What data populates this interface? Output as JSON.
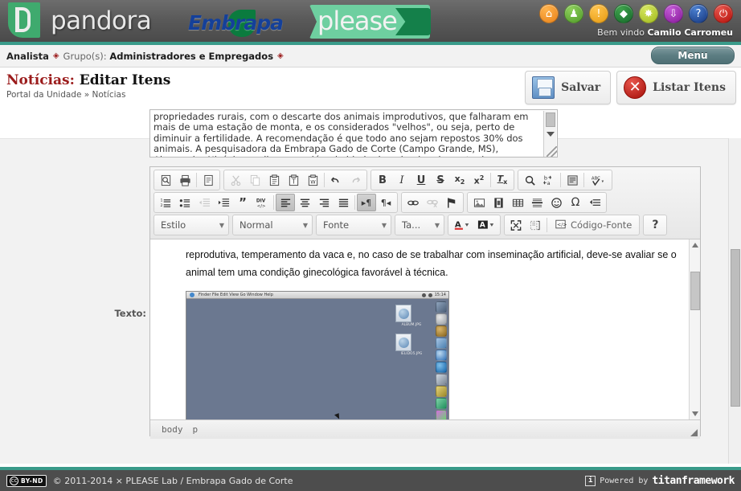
{
  "header": {
    "logos": {
      "pandora": "pandora",
      "embrapa": "Embrapa",
      "please": "please"
    },
    "icons": [
      {
        "name": "home-icon",
        "glyph": "⌂"
      },
      {
        "name": "user-icon",
        "glyph": "♟"
      },
      {
        "name": "alert-icon",
        "glyph": "!"
      },
      {
        "name": "brazil-flag-icon",
        "glyph": "◆"
      },
      {
        "name": "config-icon",
        "glyph": "✸"
      },
      {
        "name": "download-icon",
        "glyph": "⬇"
      },
      {
        "name": "shield-help-icon",
        "glyph": "?"
      },
      {
        "name": "power-logout-icon",
        "glyph": "⏻"
      }
    ],
    "welcome_prefix": "Bem vindo ",
    "welcome_user": "Camilo Carromeu"
  },
  "navbar": {
    "role": "Analista",
    "diamond": "◈",
    "groups_label": "Grupo(s):",
    "groups_value": "Administradores e Empregados",
    "menu_label": "Menu"
  },
  "page": {
    "title_highlight": "Notícias:",
    "title_rest": " Editar Itens",
    "breadcrumb": "Portal da Unidade » Notícias",
    "actions": [
      {
        "name": "save-button",
        "label": "Salvar",
        "icon": "floppy-disk-icon"
      },
      {
        "name": "list-items-button",
        "label": "Listar Itens",
        "icon": "red-x-circle-icon"
      }
    ]
  },
  "top_textarea": {
    "value": "propriedades rurais, com o descarte dos animais improdutivos, que falharam em mais de uma estação de monta, e os considerados \"velhos\", ou seja, perto de diminuir a fertilidade. A recomendação é que todo ano sejam repostos 30% dos animais. A pesquisadora da Embrapa Gado de Corte (Campo Grande, MS), Alessandra Nicácio, explica que, além da idade do animal, o descarte deve considerar vários critérios."
  },
  "form": {
    "text_label": "Texto:"
  },
  "editor": {
    "toolbar_row1": {
      "group1": [
        {
          "name": "preview-icon",
          "title": "Visualizar"
        },
        {
          "name": "print-icon",
          "title": "Imprimir"
        },
        {
          "name": "templates-icon",
          "title": "Modelos"
        }
      ],
      "group2": [
        {
          "name": "cut-icon",
          "title": "Recortar",
          "disabled": true
        },
        {
          "name": "copy-icon",
          "title": "Copiar",
          "disabled": true
        },
        {
          "name": "paste-icon",
          "title": "Colar"
        },
        {
          "name": "paste-text-icon",
          "title": "Colar como texto sem formatação"
        },
        {
          "name": "paste-word-icon",
          "title": "Colar do Word"
        },
        {
          "name": "undo-icon",
          "title": "Desfazer"
        },
        {
          "name": "redo-icon",
          "title": "Refazer",
          "disabled": true
        }
      ],
      "group3": [
        {
          "name": "bold-icon",
          "label": "B"
        },
        {
          "name": "italic-icon",
          "label": "I"
        },
        {
          "name": "underline-icon",
          "label": "U"
        },
        {
          "name": "strikethrough-icon",
          "label": "S"
        },
        {
          "name": "subscript-icon",
          "label": "x₂"
        },
        {
          "name": "superscript-icon",
          "label": "x²"
        },
        {
          "name": "remove-format-icon",
          "label": "Tx"
        }
      ],
      "group4": [
        {
          "name": "find-icon",
          "title": "Localizar"
        },
        {
          "name": "replace-icon",
          "title": "Substituir"
        },
        {
          "name": "select-all-icon",
          "title": "Selecionar Tudo"
        },
        {
          "name": "spellcheck-icon",
          "title": "Verificar Ortografia"
        }
      ]
    },
    "toolbar_row2": {
      "group1": [
        {
          "name": "numbered-list-icon",
          "title": "Lista Numerada"
        },
        {
          "name": "bulleted-list-icon",
          "title": "Lista com Marcadores"
        },
        {
          "name": "outdent-icon",
          "title": "Diminuir Recuo",
          "disabled": true
        },
        {
          "name": "indent-icon",
          "title": "Aumentar Recuo"
        },
        {
          "name": "blockquote-icon",
          "title": "Citação"
        },
        {
          "name": "div-container-icon",
          "title": "Criar DIV"
        },
        {
          "name": "align-left-icon",
          "title": "Alinhar à Esquerda",
          "active": true
        },
        {
          "name": "align-center-icon",
          "title": "Centralizar"
        },
        {
          "name": "align-right-icon",
          "title": "Alinhar à Direita"
        },
        {
          "name": "justify-icon",
          "title": "Justificado"
        },
        {
          "name": "ltr-icon",
          "title": "Da esquerda para a direita",
          "active": true
        },
        {
          "name": "rtl-icon",
          "title": "Da direita para a esquerda"
        }
      ],
      "group2": [
        {
          "name": "link-icon",
          "title": "Link"
        },
        {
          "name": "unlink-icon",
          "title": "Remover Link",
          "disabled": true
        },
        {
          "name": "anchor-icon",
          "title": "Âncora"
        }
      ],
      "group3": [
        {
          "name": "image-icon",
          "title": "Imagem"
        },
        {
          "name": "flash-icon",
          "title": "Flash"
        },
        {
          "name": "table-icon",
          "title": "Tabela"
        },
        {
          "name": "horizontal-rule-icon",
          "title": "Linha Horizontal"
        },
        {
          "name": "smiley-icon",
          "title": "Emoticon"
        },
        {
          "name": "special-char-icon",
          "title": "Caractere Especial"
        },
        {
          "name": "page-break-icon",
          "title": "Quebra de Página"
        }
      ]
    },
    "toolbar_row3": {
      "selects": [
        {
          "name": "style-select",
          "value": "Estilo"
        },
        {
          "name": "format-select",
          "value": "Normal"
        },
        {
          "name": "font-select",
          "value": "Fonte"
        },
        {
          "name": "size-select",
          "value": "Ta..."
        }
      ],
      "colors": [
        {
          "name": "text-color-icon",
          "label": "A"
        },
        {
          "name": "background-color-icon",
          "label": "A"
        }
      ],
      "tools": [
        {
          "name": "maximize-icon",
          "title": "Maximizar"
        },
        {
          "name": "show-blocks-icon",
          "title": "Mostrar Blocos"
        }
      ],
      "source_label": "Código-Fonte",
      "source_icon": "source-code-icon",
      "help_label": "?",
      "help_icon": "help-icon"
    },
    "content": {
      "paragraph": "reprodutiva, temperamento da vaca e, no caso de se trabalhar com inseminação artificial, deve-se avaliar se o animal tem uma condição ginecológica favorável à técnica.",
      "embedded_image": {
        "name": "embedded-desktop-screenshot",
        "menubar": "Finder  File  Edit  View  Go  Window  Help",
        "clock": "15:14",
        "desktop_icons": [
          "ALBUM.JPG",
          "IELIDO5.JPG"
        ]
      }
    },
    "status_path": [
      "body",
      "p"
    ]
  },
  "footer": {
    "license_cc": "cc",
    "license_type": "BY-ND",
    "copyright": "© 2011-2014 × PLEASE Lab / Embrapa Gado de Corte",
    "powered_label": "Powered by",
    "powered_brand": "titanframework",
    "info_icon": "info-icon"
  },
  "colors": {
    "accent_teal": "#3a9b8a",
    "title_red": "#9b1c1c",
    "header_gray": "#5a5a5a",
    "pandora_green": "#3faa6e",
    "embrapa_blue": "#14409a"
  }
}
